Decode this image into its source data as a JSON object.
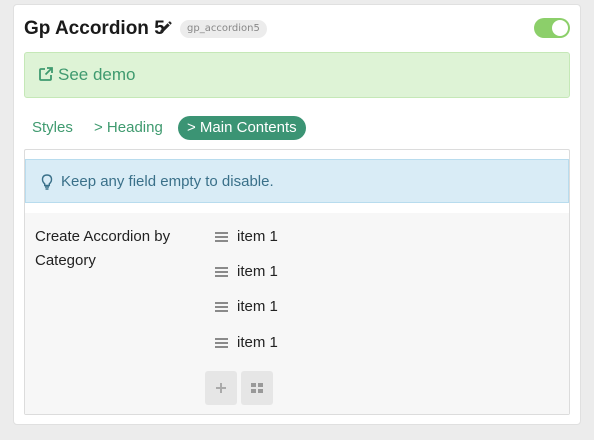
{
  "header": {
    "title": "Gp Accordion 5",
    "slug": "gp_accordion5",
    "enabled": true,
    "toggle_color": "#8ccf6a"
  },
  "demo": {
    "label": "See demo",
    "icon": "external-link-icon",
    "color": "#3f9a6f"
  },
  "tabs": [
    {
      "label": "Styles",
      "active": false
    },
    {
      "label": "> Heading",
      "active": false
    },
    {
      "label": "> Main Contents",
      "active": true
    }
  ],
  "info": {
    "icon": "lightbulb-icon",
    "text": "Keep any field empty to disable."
  },
  "field": {
    "label": "Create Accordion by Category",
    "items": [
      {
        "label": "item 1"
      },
      {
        "label": "item 1"
      },
      {
        "label": "item 1"
      },
      {
        "label": "item 1"
      }
    ],
    "buttons": [
      {
        "icon": "plus-icon"
      },
      {
        "icon": "grid-icon"
      }
    ]
  }
}
